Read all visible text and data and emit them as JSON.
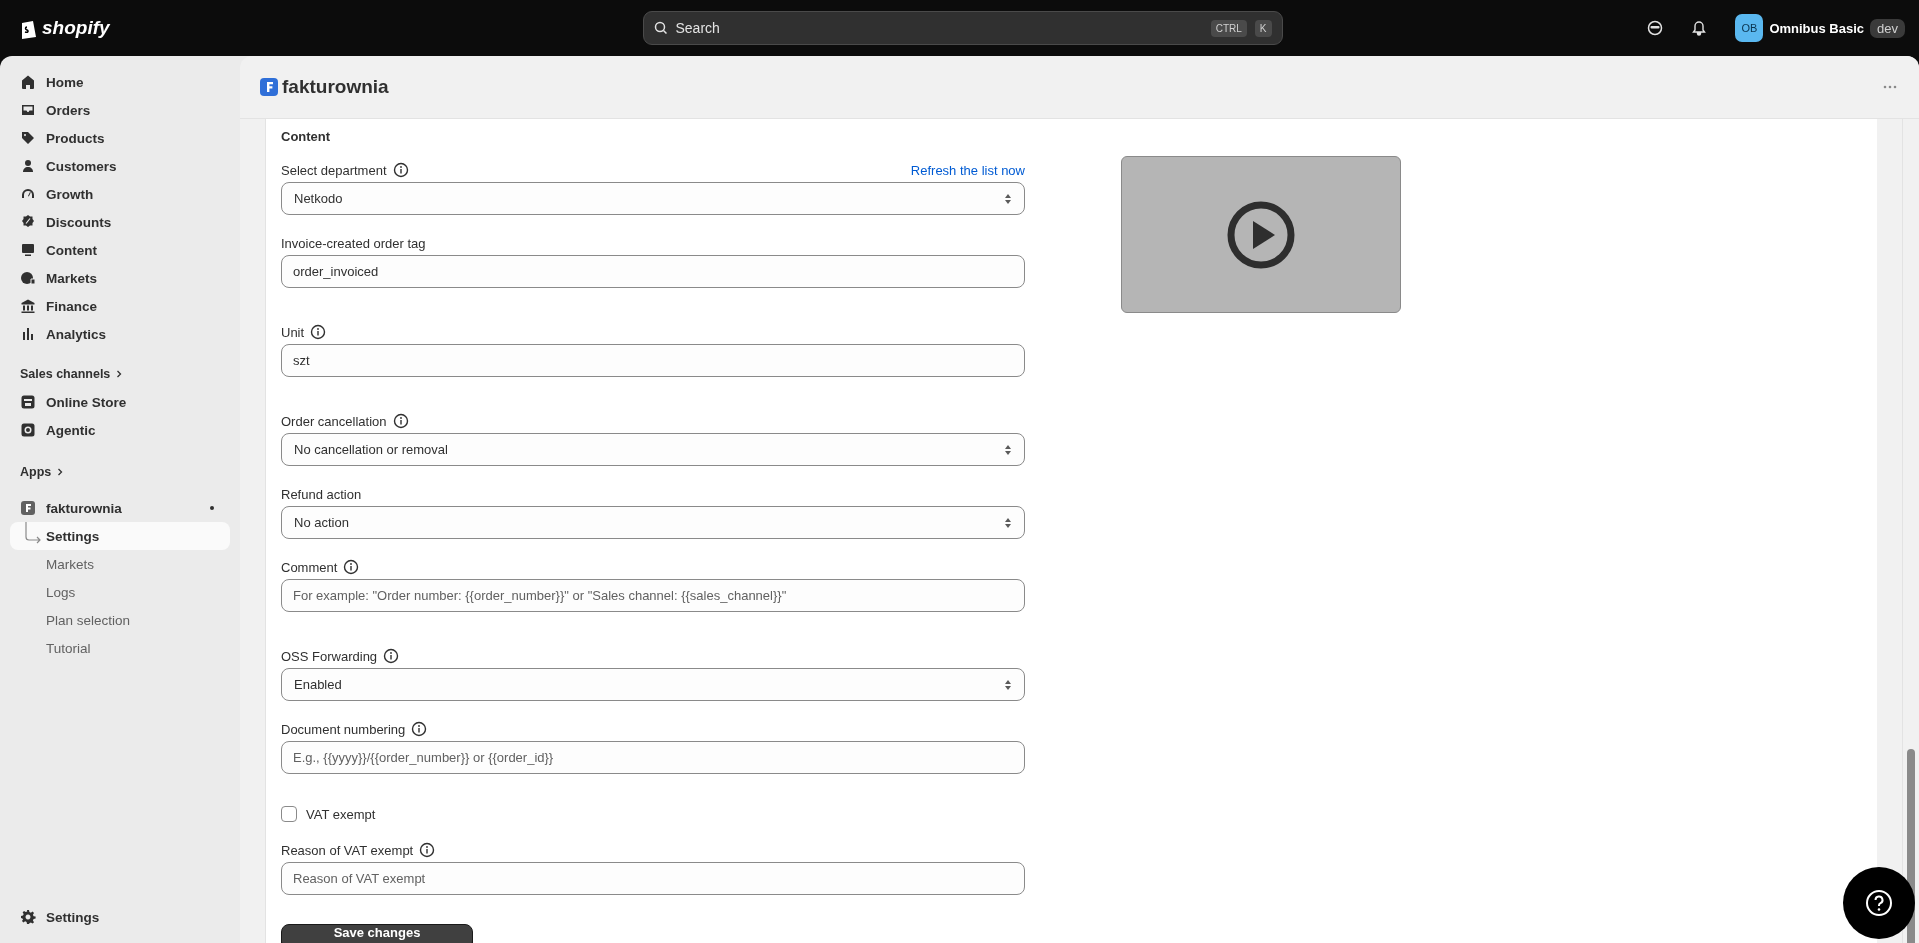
{
  "topbar": {
    "logo": "shopify",
    "search": {
      "placeholder": "Search",
      "keys": [
        "CTRL",
        "K"
      ]
    },
    "store": {
      "initials": "OB",
      "name": "Omnibus Basic",
      "badge": "dev"
    }
  },
  "sidebar": {
    "items": [
      {
        "label": "Home",
        "selected": false
      },
      {
        "label": "Orders",
        "selected": false
      },
      {
        "label": "Products",
        "selected": false
      },
      {
        "label": "Customers",
        "selected": false
      },
      {
        "label": "Growth",
        "selected": false
      },
      {
        "label": "Discounts",
        "selected": false
      },
      {
        "label": "Content",
        "selected": false
      },
      {
        "label": "Markets",
        "selected": false
      },
      {
        "label": "Finance",
        "selected": false
      },
      {
        "label": "Analytics",
        "selected": false
      }
    ],
    "sales_channels": {
      "title": "Sales channels",
      "items": [
        {
          "label": "Online Store",
          "selected": false
        },
        {
          "label": "Agentic",
          "selected": false
        }
      ]
    },
    "apps": {
      "title": "Apps",
      "app": {
        "label": "fakturownia",
        "children": [
          {
            "label": "Settings",
            "selected": true
          },
          {
            "label": "Markets",
            "selected": false
          },
          {
            "label": "Logs",
            "selected": false
          },
          {
            "label": "Plan selection",
            "selected": false
          },
          {
            "label": "Tutorial",
            "selected": false
          }
        ]
      }
    },
    "footer_item": {
      "label": "Settings",
      "selected": false
    }
  },
  "header": {
    "title": "fakturownia"
  },
  "form": {
    "section_title": "Content",
    "fields": [
      {
        "kind": "select",
        "label": "Select department",
        "info": true,
        "link": "Refresh the list now",
        "value": "Netkodo"
      },
      {
        "kind": "text",
        "label": "Invoice-created order tag",
        "info": false,
        "value": "order_invoiced"
      },
      {
        "kind": "text",
        "label": "Unit",
        "info": true,
        "value": "szt"
      },
      {
        "kind": "select",
        "label": "Order cancellation",
        "info": true,
        "value": "No cancellation or removal"
      },
      {
        "kind": "select",
        "label": "Refund action",
        "info": false,
        "value": "No action"
      },
      {
        "kind": "text",
        "label": "Comment",
        "info": true,
        "placeholder": "For example: \"Order number: {{order_number}}\" or \"Sales channel: {{sales_channel}}\""
      },
      {
        "kind": "select",
        "label": "OSS Forwarding",
        "info": true,
        "value": "Enabled"
      },
      {
        "kind": "text",
        "label": "Document numbering",
        "info": true,
        "placeholder": "E.g., {{yyyy}}/{{order_number}} or {{order_id}}"
      },
      {
        "kind": "checkbox",
        "label": "VAT exempt",
        "checked": false
      },
      {
        "kind": "text",
        "label": "Reason of VAT exempt",
        "info": true,
        "placeholder": "Reason of VAT exempt"
      }
    ],
    "save_button": "Save changes"
  }
}
